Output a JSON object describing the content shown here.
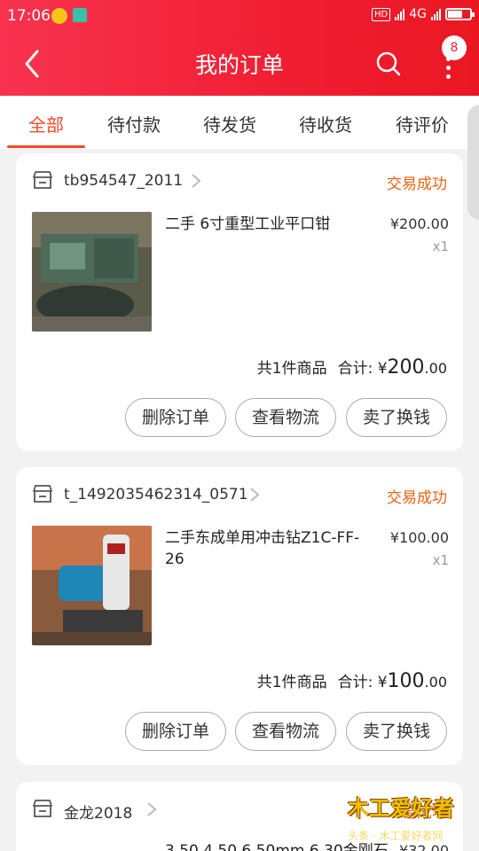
{
  "statusbar": {
    "time": "17:06",
    "hd": "HD",
    "network": "4G"
  },
  "header": {
    "title": "我的订单",
    "badge": "8"
  },
  "tabs": [
    {
      "label": "全部",
      "active": true
    },
    {
      "label": "待付款",
      "active": false
    },
    {
      "label": "待发货",
      "active": false
    },
    {
      "label": "待收货",
      "active": false
    },
    {
      "label": "待评价",
      "active": false
    }
  ],
  "orders": [
    {
      "shop": "tb954547_2011",
      "status": "交易成功",
      "item_title": "二手 6寸重型工业平口钳",
      "price": "¥200.00",
      "qty": "x1",
      "count_text": "共1件商品",
      "total_label": "合计: ¥",
      "total_int": "200",
      "total_dec": ".00",
      "buttons": [
        "删除订单",
        "查看物流",
        "卖了换钱"
      ]
    },
    {
      "shop": "t_1492035462314_0571",
      "status": "交易成功",
      "item_title": "二手东成单用冲击钻Z1C-FF-26",
      "price": "¥100.00",
      "qty": "x1",
      "count_text": "共1件商品",
      "total_label": "合计: ¥",
      "total_int": "100",
      "total_dec": ".00",
      "buttons": [
        "删除订单",
        "查看物流",
        "卖了换钱"
      ]
    },
    {
      "shop": "金龙2018",
      "status": "易成功",
      "item_title": "3.50 4.50 6.50mm 6.30金刚石",
      "price": "¥32.00"
    }
  ],
  "watermark": {
    "logo": "木工爱好者",
    "sub": "头条 · 木工爱好者网"
  }
}
